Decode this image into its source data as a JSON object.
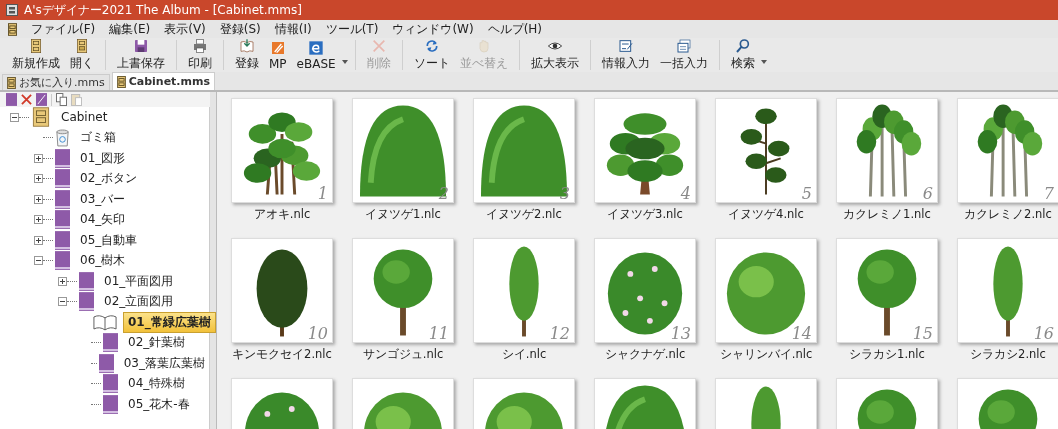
{
  "window": {
    "title": "A'sデザイナー2021 The Album - [Cabinet.mms]"
  },
  "menu": [
    "ファイル(F)",
    "編集(E)",
    "表示(V)",
    "登録(S)",
    "情報(I)",
    "ツール(T)",
    "ウィンドウ(W)",
    "ヘルプ(H)"
  ],
  "toolbar": [
    {
      "label": "新規作成",
      "kind": "new",
      "disabled": false
    },
    {
      "label": "開く",
      "kind": "open",
      "disabled": false
    },
    {
      "kind": "separator"
    },
    {
      "label": "上書保存",
      "kind": "save",
      "disabled": false
    },
    {
      "kind": "separator"
    },
    {
      "label": "印刷",
      "kind": "print",
      "disabled": false
    },
    {
      "kind": "separator"
    },
    {
      "label": "登録",
      "kind": "register",
      "disabled": false
    },
    {
      "label": "MP",
      "kind": "mp",
      "disabled": false
    },
    {
      "label": "eBASE",
      "kind": "ebase",
      "disabled": false
    },
    {
      "kind": "dropdown"
    },
    {
      "kind": "separator"
    },
    {
      "label": "削除",
      "kind": "delete",
      "disabled": true
    },
    {
      "kind": "separator"
    },
    {
      "label": "ソート",
      "kind": "sort",
      "disabled": false
    },
    {
      "label": "並べ替え",
      "kind": "hand",
      "disabled": true
    },
    {
      "kind": "separator"
    },
    {
      "label": "拡大表示",
      "kind": "zoom",
      "disabled": false
    },
    {
      "kind": "separator"
    },
    {
      "label": "情報入力",
      "kind": "info",
      "disabled": false
    },
    {
      "label": "一括入力",
      "kind": "batch",
      "disabled": false
    },
    {
      "kind": "separator"
    },
    {
      "label": "検索",
      "kind": "search",
      "disabled": false
    },
    {
      "kind": "dropdown"
    }
  ],
  "tabs": [
    {
      "label": "お気に入り.mms",
      "selected": false
    },
    {
      "label": "Cabinet.mms",
      "selected": true
    }
  ],
  "tree": [
    {
      "label": "Cabinet",
      "kind": "cabinet",
      "expanded": true,
      "selected": false,
      "children": [
        {
          "label": "ゴミ箱",
          "kind": "trash",
          "selected": false
        },
        {
          "label": "01_図形",
          "kind": "folder",
          "expanded": false,
          "selected": false
        },
        {
          "label": "02_ボタン",
          "kind": "folder",
          "expanded": false,
          "selected": false
        },
        {
          "label": "03_バー",
          "kind": "folder",
          "expanded": false,
          "selected": false
        },
        {
          "label": "04_矢印",
          "kind": "folder",
          "expanded": false,
          "selected": false
        },
        {
          "label": "05_自動車",
          "kind": "folder",
          "expanded": false,
          "selected": false
        },
        {
          "label": "06_樹木",
          "kind": "folder",
          "expanded": true,
          "selected": false,
          "children": [
            {
              "label": "01_平面図用",
              "kind": "folder",
              "expanded": false,
              "selected": false
            },
            {
              "label": "02_立面図用",
              "kind": "folder",
              "expanded": true,
              "selected": false,
              "children": [
                {
                  "label": "01_常緑広葉樹",
                  "kind": "book",
                  "selected": true
                },
                {
                  "label": "02_針葉樹",
                  "kind": "folder",
                  "selected": false
                },
                {
                  "label": "03_落葉広葉樹",
                  "kind": "folder",
                  "selected": false
                },
                {
                  "label": "04_特殊樹",
                  "kind": "folder",
                  "selected": false
                },
                {
                  "label": "05_花木-春",
                  "kind": "folder",
                  "selected": false
                }
              ]
            }
          ]
        }
      ]
    }
  ],
  "thumbnails": [
    {
      "label": "アオキ.nlc",
      "number": "1",
      "kind": "bush"
    },
    {
      "label": "イヌツゲ1.nlc",
      "number": "2",
      "kind": "dome"
    },
    {
      "label": "イヌツゲ2.nlc",
      "number": "3",
      "kind": "dome"
    },
    {
      "label": "イヌツゲ3.nlc",
      "number": "4",
      "kind": "layered"
    },
    {
      "label": "イヌツゲ4.nlc",
      "number": "5",
      "kind": "tiers"
    },
    {
      "label": "カクレミノ1.nlc",
      "number": "6",
      "kind": "stems"
    },
    {
      "label": "カクレミノ2.nlc",
      "number": "7",
      "kind": "stems"
    },
    {
      "label": "キンモクセイ2.nlc",
      "number": "10",
      "kind": "column"
    },
    {
      "label": "サンゴジュ.nlc",
      "number": "11",
      "kind": "round"
    },
    {
      "label": "シイ.nlc",
      "number": "12",
      "kind": "slim"
    },
    {
      "label": "シャクナゲ.nlc",
      "number": "13",
      "kind": "flower"
    },
    {
      "label": "シャリンバイ.nlc",
      "number": "14",
      "kind": "shrub"
    },
    {
      "label": "シラカシ1.nlc",
      "number": "15",
      "kind": "round"
    },
    {
      "label": "シラカシ2.nlc",
      "number": "16",
      "kind": "slim"
    },
    {
      "kind": "flower"
    },
    {
      "kind": "shrub"
    },
    {
      "kind": "shrub"
    },
    {
      "kind": "dome"
    },
    {
      "kind": "slim"
    },
    {
      "kind": "round"
    },
    {
      "kind": "round"
    }
  ]
}
